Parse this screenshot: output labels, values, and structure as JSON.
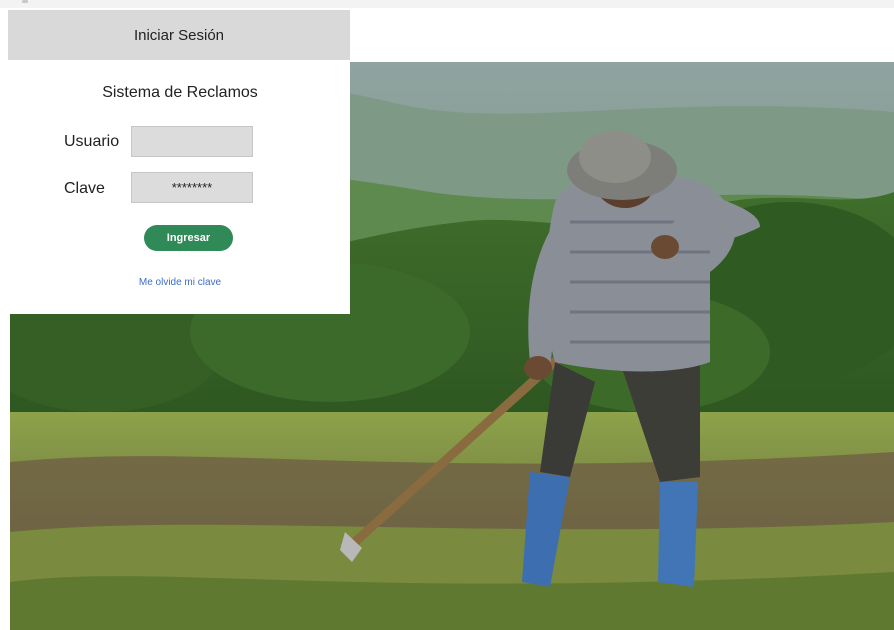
{
  "login": {
    "header_title": "Iniciar Sesión",
    "panel_title": "Sistema de Reclamos",
    "username_label": "Usuario",
    "username_value": "",
    "password_label": "Clave",
    "password_value": "********",
    "submit_label": "Ingresar",
    "forgot_link": "Me olvide mi clave"
  },
  "colors": {
    "header_bg": "#d9d9d9",
    "button_green": "#2f8a57",
    "link_blue": "#3a6fc9",
    "field_bg": "#dcdcdc"
  },
  "background": {
    "description_icon": "farmer-hoeing-field-photo"
  }
}
